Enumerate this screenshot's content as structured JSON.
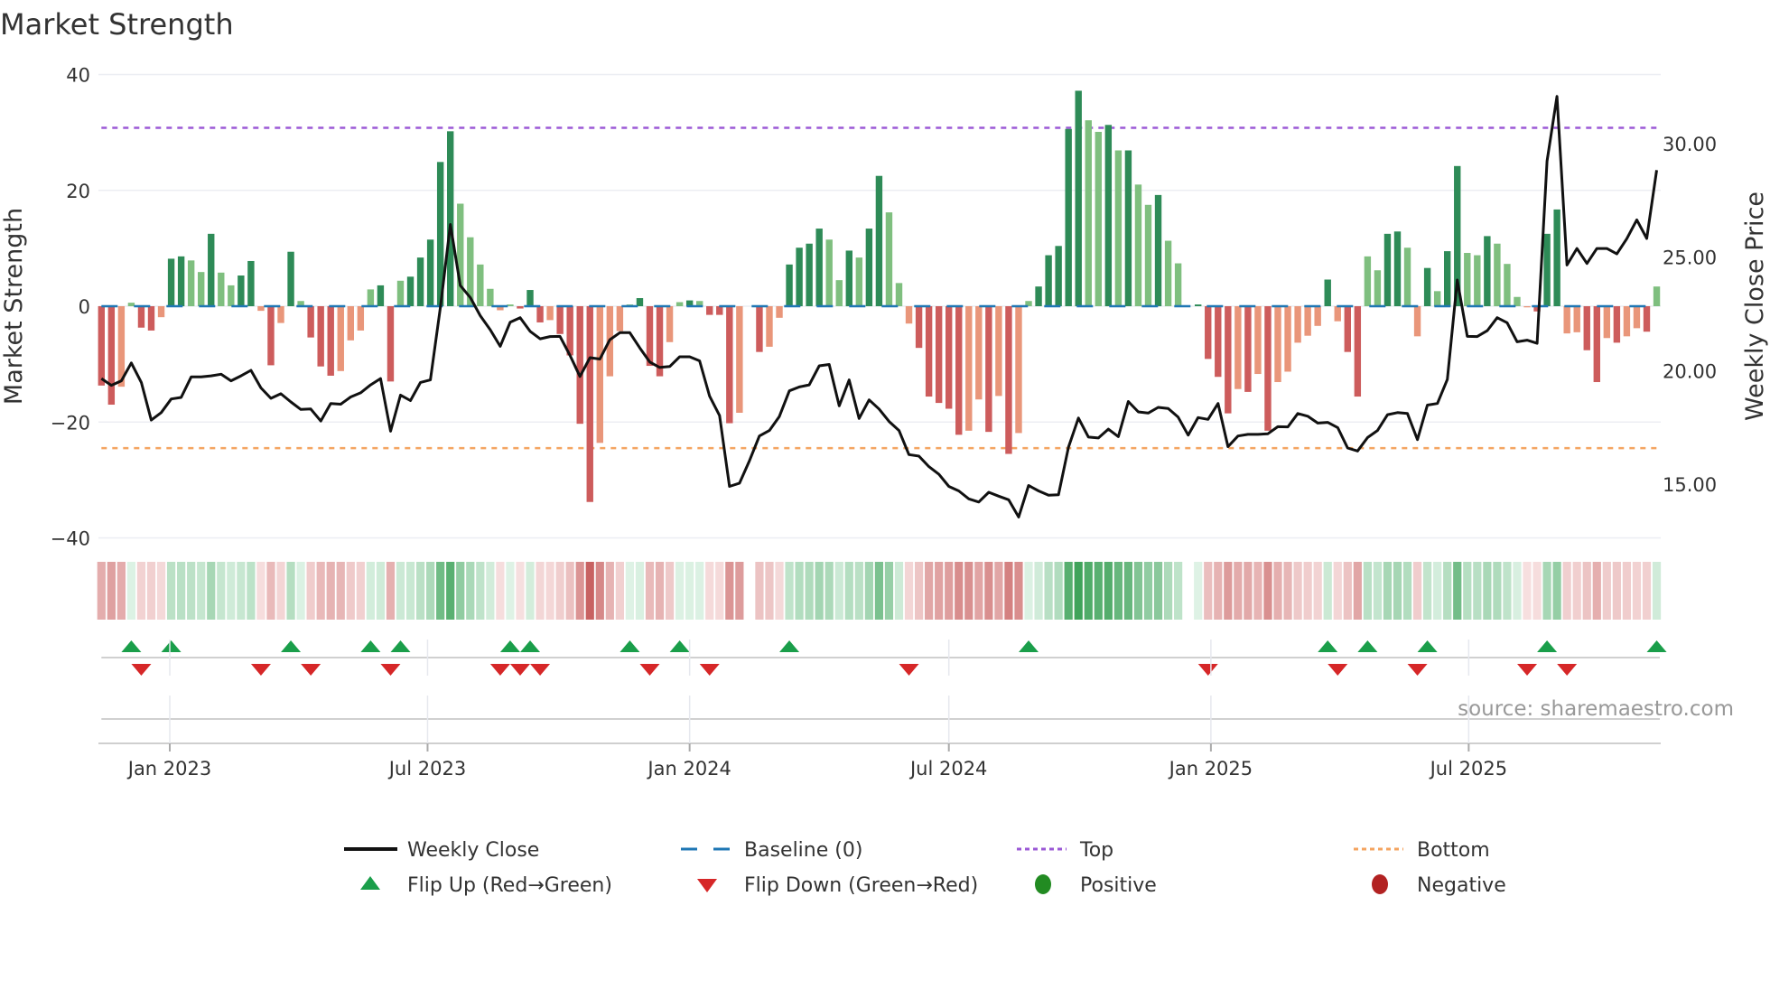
{
  "chart_data": {
    "type": "bar",
    "title": "Market Strength",
    "ylabel": "Market Strength",
    "y2label": "Weekly Close Price",
    "ylim": [
      -40,
      40
    ],
    "y2lim": [
      12.61,
      33.04
    ],
    "y_ticks": [
      {
        "value": 40,
        "label": "40"
      },
      {
        "value": 20,
        "label": "20"
      },
      {
        "value": 0,
        "label": "0"
      },
      {
        "value": -20,
        "label": "−20"
      },
      {
        "value": -40,
        "label": "−40"
      }
    ],
    "y2_ticks": [
      {
        "value": 30,
        "label": "30.00"
      },
      {
        "value": 25,
        "label": "25.00"
      },
      {
        "value": 20,
        "label": "20.00"
      },
      {
        "value": 15,
        "label": "15.00"
      }
    ],
    "x_start": "2022-11-14",
    "x_step_days": 7,
    "x_ticks": [
      {
        "date": "2023-01-01",
        "label": "Jan 2023"
      },
      {
        "date": "2023-07-01",
        "label": "Jul 2023"
      },
      {
        "date": "2024-01-01",
        "label": "Jan 2024"
      },
      {
        "date": "2024-07-01",
        "label": "Jul 2024"
      },
      {
        "date": "2025-01-01",
        "label": "Jan 2025"
      },
      {
        "date": "2025-07-01",
        "label": "Jul 2025"
      }
    ],
    "top_level": 30.8,
    "bottom_level": -24.5,
    "baseline": 0,
    "strength": [
      -13.7,
      -17,
      -13.9,
      0.6,
      -3.7,
      -4.2,
      -1.9,
      8.2,
      8.6,
      7.9,
      5.9,
      12.5,
      5.8,
      3.6,
      5.3,
      7.8,
      -0.8,
      -10.2,
      -2.9,
      9.4,
      0.9,
      -5.4,
      -10.4,
      -12,
      -11.2,
      -5.9,
      -4.2,
      2.9,
      3.6,
      -13,
      4.4,
      5.1,
      8.4,
      11.5,
      24.9,
      30.2,
      17.7,
      11.9,
      7.2,
      3.0,
      -0.7,
      0.3,
      -0.4,
      2.8,
      -2.8,
      -2.4,
      -4.8,
      -8.5,
      -20.3,
      -33.8,
      -23.6,
      -12.1,
      -4.3,
      0.3,
      1.4,
      -10.3,
      -12.1,
      -6.2,
      0.7,
      1.0,
      0.9,
      -1.5,
      -1.5,
      -20.2,
      -18.4,
      0,
      -7.9,
      -7,
      -2,
      7.2,
      10.1,
      10.8,
      13.4,
      11.5,
      4.5,
      9.6,
      8.4,
      13.4,
      22.5,
      16.2,
      4.0,
      -3,
      -7.2,
      -15.6,
      -16.7,
      -17.7,
      -22.2,
      -21.5,
      -16.1,
      -21.7,
      -15.5,
      -25.5,
      -21.9,
      0.9,
      3.4,
      8.8,
      10.4,
      30.6,
      37.2,
      32.1,
      30.1,
      31.3,
      26.9,
      26.9,
      21,
      17.5,
      19.2,
      11.3,
      7.4,
      0,
      0.3,
      -9.1,
      -12.2,
      -18.5,
      -14.3,
      -14.8,
      -11.7,
      -21.5,
      -13.1,
      -11.3,
      -6.3,
      -5.1,
      -3.4,
      4.6,
      -2.6,
      -7.9,
      -15.6,
      8.6,
      6.2,
      12.5,
      12.9,
      10.1,
      -5.2,
      6.6,
      2.6,
      9.5,
      24.2,
      9.2,
      8.8,
      12.1,
      10.8,
      7.3,
      1.6,
      -0.2,
      -0.9,
      12.5,
      16.7,
      -4.7,
      -4.5,
      -7.6,
      -13.1,
      -5.5,
      -6.3,
      -5.2,
      -3.8,
      -4.4,
      3.4
    ],
    "weekly_close": [
      19.65,
      19.35,
      19.55,
      20.34,
      19.48,
      17.82,
      18.15,
      18.75,
      18.82,
      19.72,
      19.72,
      19.77,
      19.84,
      19.55,
      19.77,
      20.01,
      19.24,
      18.78,
      18.98,
      18.62,
      18.29,
      18.31,
      17.78,
      18.55,
      18.52,
      18.84,
      19.02,
      19.37,
      19.65,
      17.33,
      18.92,
      18.68,
      19.48,
      19.59,
      22.8,
      26.44,
      23.75,
      23.22,
      22.42,
      21.8,
      21.07,
      22.13,
      22.33,
      21.73,
      21.4,
      21.5,
      21.51,
      20.67,
      19.74,
      20.57,
      20.51,
      21.36,
      21.67,
      21.67,
      21.0,
      20.38,
      20.14,
      20.18,
      20.61,
      20.61,
      20.43,
      18.88,
      18.02,
      14.9,
      15.04,
      16.03,
      17.12,
      17.36,
      17.98,
      19.11,
      19.28,
      19.37,
      20.21,
      20.27,
      18.45,
      19.59,
      17.89,
      18.71,
      18.31,
      17.76,
      17.36,
      16.3,
      16.23,
      15.77,
      15.43,
      14.9,
      14.7,
      14.35,
      14.21,
      14.64,
      14.47,
      14.31,
      13.55,
      14.94,
      14.7,
      14.51,
      14.53,
      16.63,
      17.91,
      17.07,
      17.03,
      17.42,
      17.09,
      18.64,
      18.18,
      18.13,
      18.38,
      18.33,
      17.95,
      17.16,
      17.93,
      17.85,
      18.55,
      16.65,
      17.12,
      17.19,
      17.19,
      17.22,
      17.53,
      17.52,
      18.11,
      17.99,
      17.69,
      17.72,
      17.49,
      16.59,
      16.46,
      17.05,
      17.36,
      18.06,
      18.15,
      18.11,
      16.96,
      18.48,
      18.55,
      19.61,
      23.99,
      21.51,
      21.5,
      21.76,
      22.33,
      22.11,
      21.27,
      21.34,
      21.2,
      29.23,
      32.08,
      24.65,
      25.38,
      24.72,
      25.38,
      25.38,
      25.14,
      25.81,
      26.64,
      25.82,
      28.83
    ],
    "flip_up_weeks": [
      4,
      8,
      20,
      28,
      31,
      42,
      44,
      54,
      59,
      70,
      94,
      124,
      128,
      134,
      146,
      157
    ],
    "flip_down_weeks": [
      5,
      17,
      22,
      30,
      41,
      43,
      45,
      56,
      62,
      82,
      112,
      125,
      133,
      144,
      148
    ],
    "legend": [
      {
        "key": "weekly_close",
        "label": "Weekly Close"
      },
      {
        "key": "baseline",
        "label": "Baseline (0)"
      },
      {
        "key": "top",
        "label": "Top"
      },
      {
        "key": "bottom",
        "label": "Bottom"
      },
      {
        "key": "flip_up",
        "label": "Flip Up (Red→Green)"
      },
      {
        "key": "flip_down",
        "label": "Flip Down (Green→Red)"
      },
      {
        "key": "positive",
        "label": "Positive"
      },
      {
        "key": "negative",
        "label": "Negative"
      }
    ],
    "legend_placement": "bottom",
    "source": "source: sharemaestro.com"
  },
  "colors": {
    "pos_strong": "#2e8b57",
    "pos_weak": "#7fbf7f",
    "neg_strong": "#cd5c5c",
    "neg_weak": "#e9967a",
    "close": "#111111",
    "baseline": "#1f77b4",
    "top": "#9b59d6",
    "bottom": "#f4a460",
    "flip_up": "#1a9e4a",
    "flip_down": "#d62728",
    "positive": "#228b22",
    "negative": "#b22222"
  }
}
